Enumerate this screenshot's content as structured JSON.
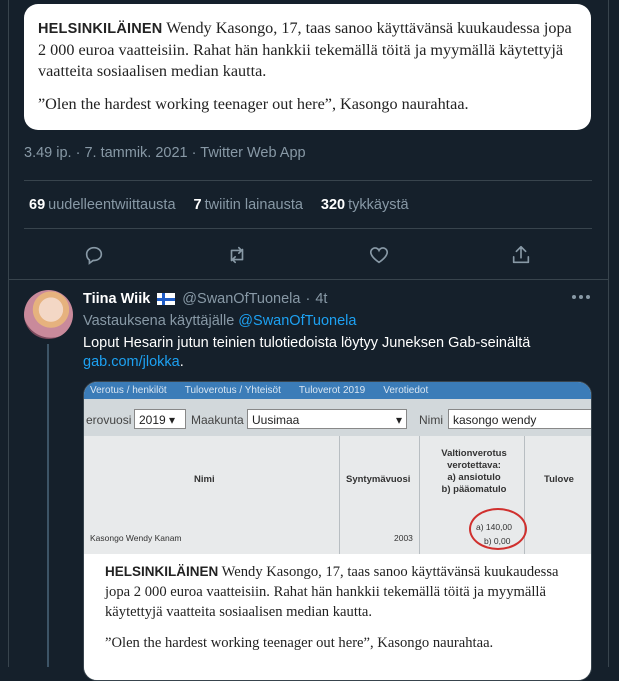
{
  "quoted_card": {
    "lead": "HELSINKILÄINEN",
    "rest": " Wendy Kasongo, 17, taas sanoo käyttävänsä kuukaudessa jopa 2 000 euroa vaatteisiin. Rahat hän hankkii tekemällä töitä ja myymällä käytettyjä vaatteita sosiaalisen median kautta.",
    "quote": "”Olen the hardest working teenager out here”, Kasongo naurahtaa."
  },
  "meta": {
    "time": "3.49 ip.",
    "sep": " · ",
    "date": "7. tammik. 2021",
    "source": "Twitter Web App"
  },
  "stats": {
    "retweets_count": "69",
    "retweets_label": "uudelleentwiittausta",
    "quotes_count": "7",
    "quotes_label": "twiitin lainausta",
    "likes_count": "320",
    "likes_label": "tykkäystä"
  },
  "icons": {
    "reply": "reply-icon",
    "retweet": "retweet-icon",
    "like": "heart-icon",
    "share": "share-icon",
    "more": "more-icon",
    "flag": "finland-flag-icon"
  },
  "colors": {
    "background": "#15202b",
    "border": "#38444d",
    "secondary_text": "#8899a6",
    "link": "#1da1f2"
  },
  "reply": {
    "name": "Tiina Wiik",
    "handle": "@SwanOfTuonela",
    "dot": "·",
    "time": "4t",
    "reply_to_prefix": "Vastauksena käyttäjälle ",
    "reply_to_mention": "@SwanOfTuonela",
    "text": "Loput Hesarin jutun teinien tulotiedoista löytyy Juneksen Gab-seinältä",
    "link": "gab.com/jlokka",
    "link_suffix": "."
  },
  "media": {
    "tabs": [
      "Verotus / henkilöt",
      "Tuloverotus / Yhteisöt",
      "Tuloverot 2019",
      "Verotiedot"
    ],
    "year_label": "erovuosi",
    "year_value": "2019",
    "region_label": "Maakunta",
    "region_value": "Uusimaa",
    "name_label": "Nimi",
    "name_value": "kasongo wendy",
    "col_name": "Nimi",
    "col_birth": "Syntymävuosi",
    "col_tax_1": "Valtionverotus",
    "col_tax_2": "verotettava:",
    "col_tax_3": "a) ansiotulo",
    "col_tax_4": "b) pääomatulo",
    "col_extra": "Tulove",
    "row_name": "Kasongo Wendy Kanam",
    "row_birth": "2003",
    "row_a": "a) 140,00",
    "row_b": "b) 0,00",
    "article_lead": "HELSINKILÄINEN",
    "article_rest": " Wendy Kasongo, 17, taas sanoo käyttävänsä kuukaudessa jopa 2 000 euroa vaatteisiin. Rahat hän hankkii tekemällä töitä ja myymällä käytettyjä vaatteita sosiaalisen median kautta.",
    "article_quote": "”Olen the hardest working teenager out here”, Kasongo naurahtaa."
  }
}
